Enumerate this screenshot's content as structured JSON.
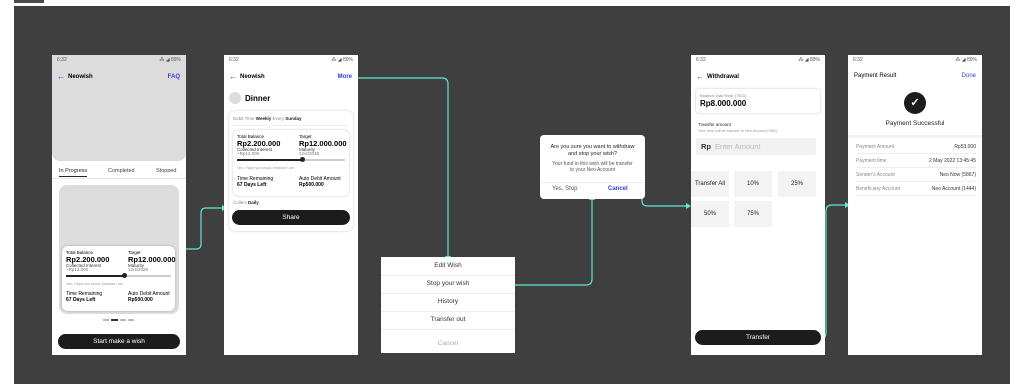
{
  "status": {
    "time": "6:32",
    "battery": "89%"
  },
  "screen1": {
    "title": "Neowish",
    "faq": "FAQ",
    "tabs": [
      "In Progress",
      "Completed",
      "Stopped"
    ],
    "card": {
      "total_label": "Total Balance",
      "total": "Rp2.200.000",
      "collected_label": "Collected Interest",
      "collected": "+Rp12.000",
      "target_label": "Target",
      "target": "Rp12.000.000",
      "maturity_label": "Maturity",
      "maturity": "12/4/2028",
      "note": "Yes, I hope you proud, because I am",
      "time_label": "Time Remaining",
      "time": "67 Days Left",
      "auto_label": "Auto Debit Amount",
      "auto": "Rp500.000"
    },
    "progress": 0.55,
    "cta": "Start make a wish"
  },
  "screen2": {
    "title": "Neowish",
    "more": "More",
    "wish_name": "Dinner",
    "debit_label": "Debit Time",
    "debit_value": "Weekly",
    "every_label": "Every",
    "every_value": "Sunday",
    "card": {
      "total_label": "Total Balance",
      "total": "Rp2.200.000",
      "collected_label": "Collected Interest",
      "collected": "+Rp12.000",
      "target_label": "Target",
      "target": "Rp12.000.000",
      "maturity_label": "Maturity",
      "maturity": "12/4/2028",
      "note": "Yes, I hope you proud, because I am",
      "time_label": "Time Remaining",
      "time": "67 Days Left",
      "auto_label": "Auto Debit Amount",
      "auto": "Rp500.000"
    },
    "progress": 0.6,
    "collect_label": "Collect",
    "collect_value": "Daily",
    "share": "Share"
  },
  "sheet": {
    "items": [
      "Edit Wish",
      "Stop your wish",
      "History",
      "Transfer out"
    ],
    "cancel": "Cancel"
  },
  "dialog": {
    "title": "Are you sure you want to withdraw and stop your wish?",
    "body": "Your fund in this wish will be transfer to your Neo Account",
    "yes": "Yes, Stop",
    "cancel": "Cancel"
  },
  "screen3": {
    "title": "Withdrawal",
    "balance_label": "Balance 'Bali Wish' (7831)",
    "balance": "Rp8.000.000",
    "transfer_label": "Transfer amount",
    "transfer_note": "Your fund will be transfer to Neo Account(7862)",
    "currency": "Rp",
    "placeholder": "Enter Amount",
    "options": [
      "Transfer All",
      "10%",
      "25%",
      "50%",
      "75%"
    ],
    "cta": "Transfer"
  },
  "screen4": {
    "title": "Payment Result",
    "done": "Done",
    "success": "Payment Successful",
    "rows": [
      {
        "k": "Payment Amount",
        "v": "Rp53,000"
      },
      {
        "k": "Payment time",
        "v": "2 May 2022 13:45:45"
      },
      {
        "k": "Sender's Account",
        "v": "Neo Now (5867)"
      },
      {
        "k": "Beneficiary Account",
        "v": "Neo Account (1444)"
      }
    ]
  },
  "colors": {
    "canvas": "#3f3f3f",
    "accent": "#2f3fd8",
    "connector": "#5ee8cf",
    "dark": "#1c1c1c"
  }
}
